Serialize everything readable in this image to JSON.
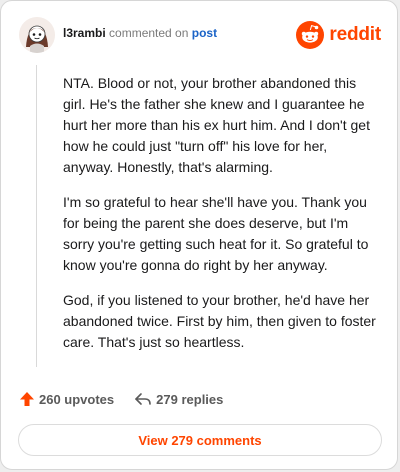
{
  "header": {
    "username": "l3rambi",
    "action": "commented on",
    "target": "post",
    "avatar_icon": "snoo-avatar-icon"
  },
  "brand": {
    "name": "reddit",
    "icon": "reddit-logo-icon",
    "color": "#ff4500"
  },
  "comment": {
    "paragraphs": [
      "NTA. Blood or not, your brother abandoned this girl. He's the father she knew and I guarantee he hurt her more than his ex hurt him. And I don't get how he could just \"turn off\" his love for her, anyway. Honestly, that's alarming.",
      "I'm so grateful to hear she'll have you. Thank you for being the parent she does deserve, but I'm sorry you're getting such heat for it. So grateful to know you're gonna do right by her anyway.",
      "God, if you listened to your brother, he'd have her abandoned twice. First by him, then given to foster care. That's just so heartless."
    ]
  },
  "footer": {
    "upvotes": "260 upvotes",
    "upvote_icon": "upvote-arrow-icon",
    "replies": "279 replies",
    "reply_icon": "reply-arrow-icon",
    "view_button": "View 279 comments"
  },
  "colors": {
    "accent": "#ff4500",
    "link": "#1a63c7",
    "text": "#1a1a1b",
    "muted": "#7a7a7a"
  }
}
